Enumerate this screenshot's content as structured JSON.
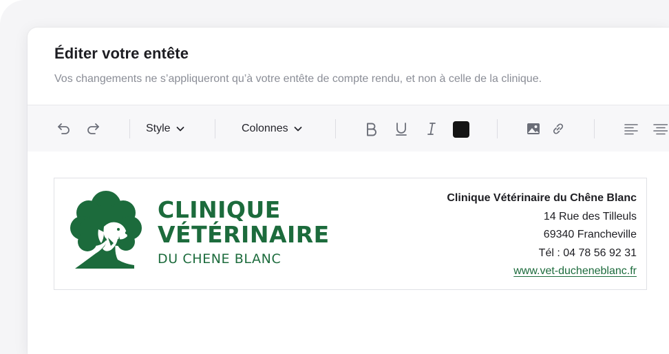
{
  "dialog": {
    "title": "Éditer votre entête",
    "subtitle": "Vos changements ne s’appliqueront qu’à votre entête de compte rendu, et non à celle de la clinique."
  },
  "toolbar": {
    "style_label": "Style",
    "columns_label": "Colonnes",
    "text_color": "#141414",
    "icons": [
      "undo-icon",
      "redo-icon",
      "chevron-down-icon",
      "bold-icon",
      "underline-icon",
      "italic-icon",
      "image-icon",
      "link-icon",
      "align-left-icon",
      "align-center-icon"
    ]
  },
  "letterhead": {
    "logo": {
      "line1": "CLINIQUE",
      "line2": "VÉTÉRINAIRE",
      "line3": "DU CHENE BLANC",
      "color": "#1c6b3c"
    },
    "clinic_name": "Clinique Vétérinaire du Chêne Blanc",
    "street": "14 Rue des Tilleuls",
    "city": "69340 Francheville",
    "phone": "Tél : 04 78 56 92 31",
    "website": "www.vet-ducheneblanc.fr"
  }
}
